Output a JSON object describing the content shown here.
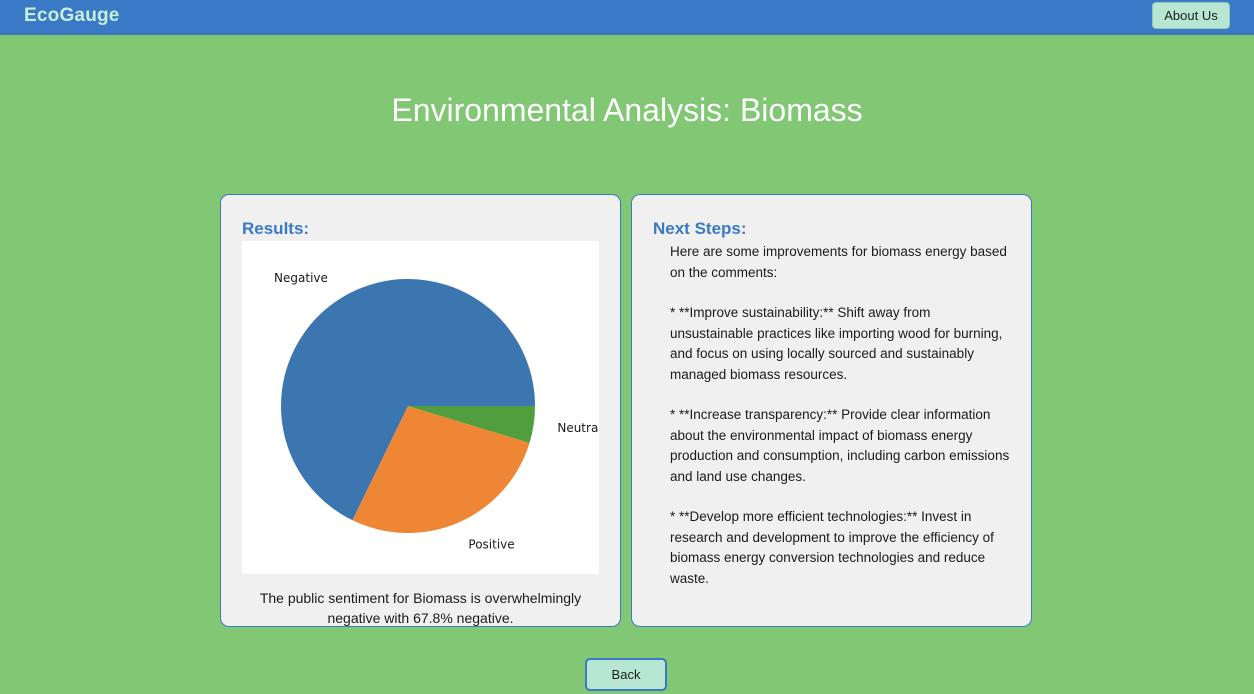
{
  "header": {
    "brand": "EcoGauge",
    "about_label": "About Us"
  },
  "page": {
    "title": "Environmental Analysis: Biomass"
  },
  "results": {
    "heading": "Results:",
    "summary": "The public sentiment for Biomass is overwhelmingly negative with 67.8% negative."
  },
  "chart_data": {
    "type": "pie",
    "categories": [
      "Negative",
      "Positive",
      "Neutral"
    ],
    "values": [
      67.8,
      27.5,
      4.7
    ],
    "colors": [
      "#3b76b0",
      "#ef8636",
      "#519e3e"
    ],
    "start_angle": 0,
    "direction": "counterclockwise"
  },
  "next_steps": {
    "heading": "Next Steps:",
    "paragraphs": [
      "Here are some improvements for biomass energy based on the comments:",
      "* **Improve sustainability:** Shift away from unsustainable practices like importing wood for burning, and focus on using locally sourced and sustainably managed biomass resources.",
      "* **Increase transparency:** Provide clear information about the environmental impact of biomass energy production and consumption, including carbon emissions and land use changes.",
      "* **Develop more efficient technologies:** Invest in research and development to improve the efficiency of biomass energy conversion technologies and reduce waste."
    ]
  },
  "footer": {
    "back_label": "Back"
  }
}
